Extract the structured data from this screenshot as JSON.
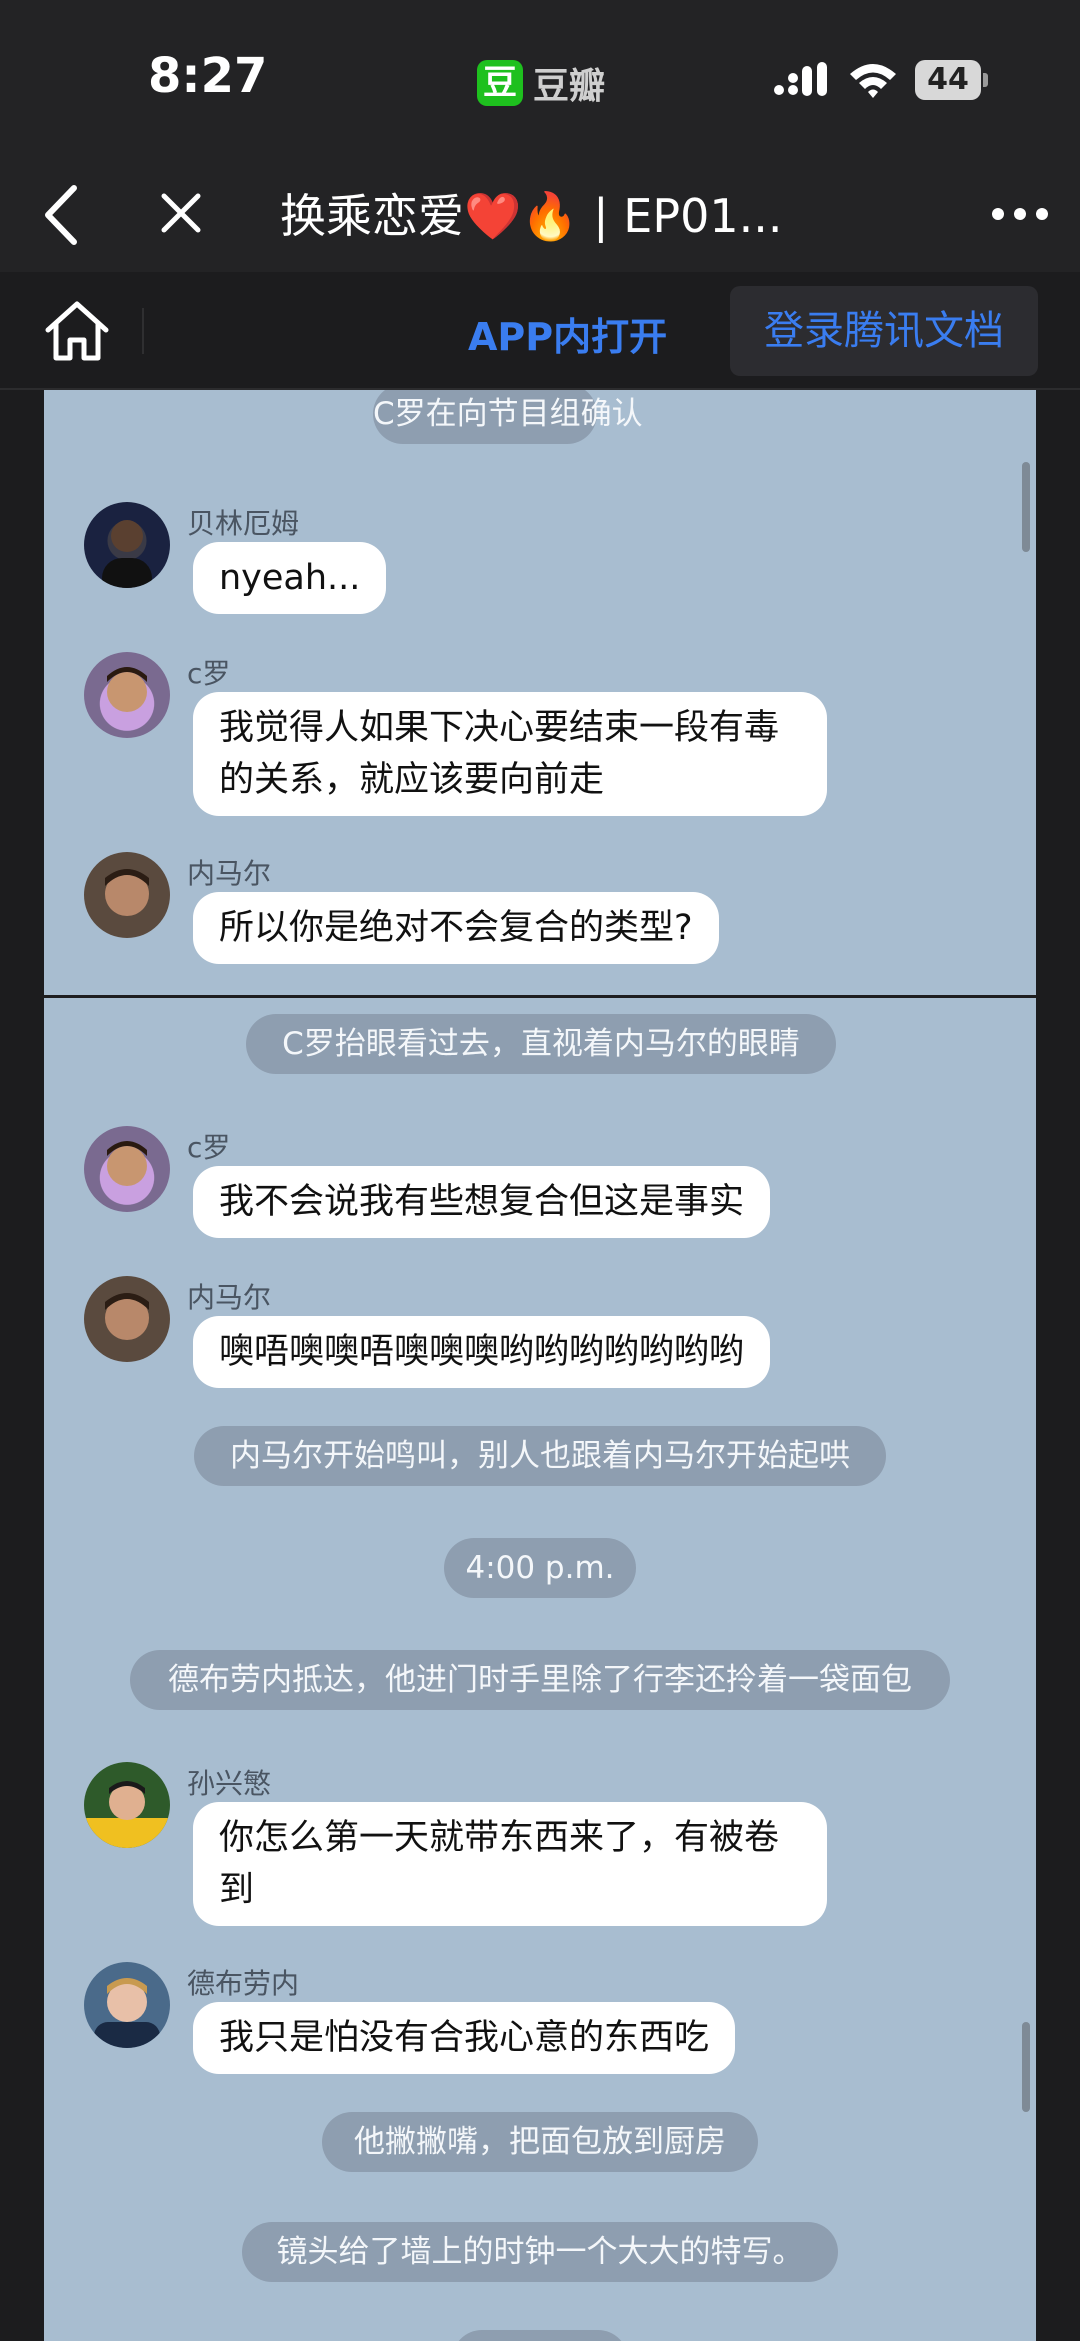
{
  "status_bar": {
    "time": "8:27",
    "app_badge_icon": "豆",
    "app_badge": "豆瓣",
    "battery": "44"
  },
  "nav": {
    "title": "换乘恋爱❤️🔥 | EP01..."
  },
  "doc_bar": {
    "open_in_app": "APP内打开",
    "login": "登录腾讯文档"
  },
  "chat": {
    "narration_1": "C罗在向节目组确认",
    "msg_1_name": "贝林厄姆",
    "msg_1_text": "nyeah...",
    "msg_2_name": "c罗",
    "msg_2_text": "我觉得人如果下决心要结束一段有毒的关系，就应该要向前走",
    "msg_3_name": "内马尔",
    "msg_3_text": "所以你是绝对不会复合的类型?",
    "narration_2": "C罗抬眼看过去，直视着内马尔的眼睛",
    "msg_4_name": "c罗",
    "msg_4_text": "我不会说我有些想复合但这是事实",
    "msg_5_name": "内马尔",
    "msg_5_text": "噢唔噢噢唔噢噢噢哟哟哟哟哟哟哟",
    "narration_3": "内马尔开始鸣叫，别人也跟着内马尔开始起哄",
    "time_stamp": "4:00 p.m.",
    "narration_4": "德布劳内抵达，他进门时手里除了行李还拎着一袋面包",
    "msg_6_name": "孙兴慜",
    "msg_6_text": "你怎么第一天就带东西来了，有被卷到",
    "msg_7_name": "德布劳内",
    "msg_7_text": "我只是怕没有合我心意的东西吃",
    "narration_5": "他撇撇嘴，把面包放到厨房",
    "narration_6": "镜头给了墙上的时钟一个大大的特写。"
  },
  "colors": {
    "page_bg": "#a8bdd0",
    "pill_bg": "#8e9eb0",
    "accent_blue": "#3a7df0",
    "app_green": "#1ec01e"
  }
}
